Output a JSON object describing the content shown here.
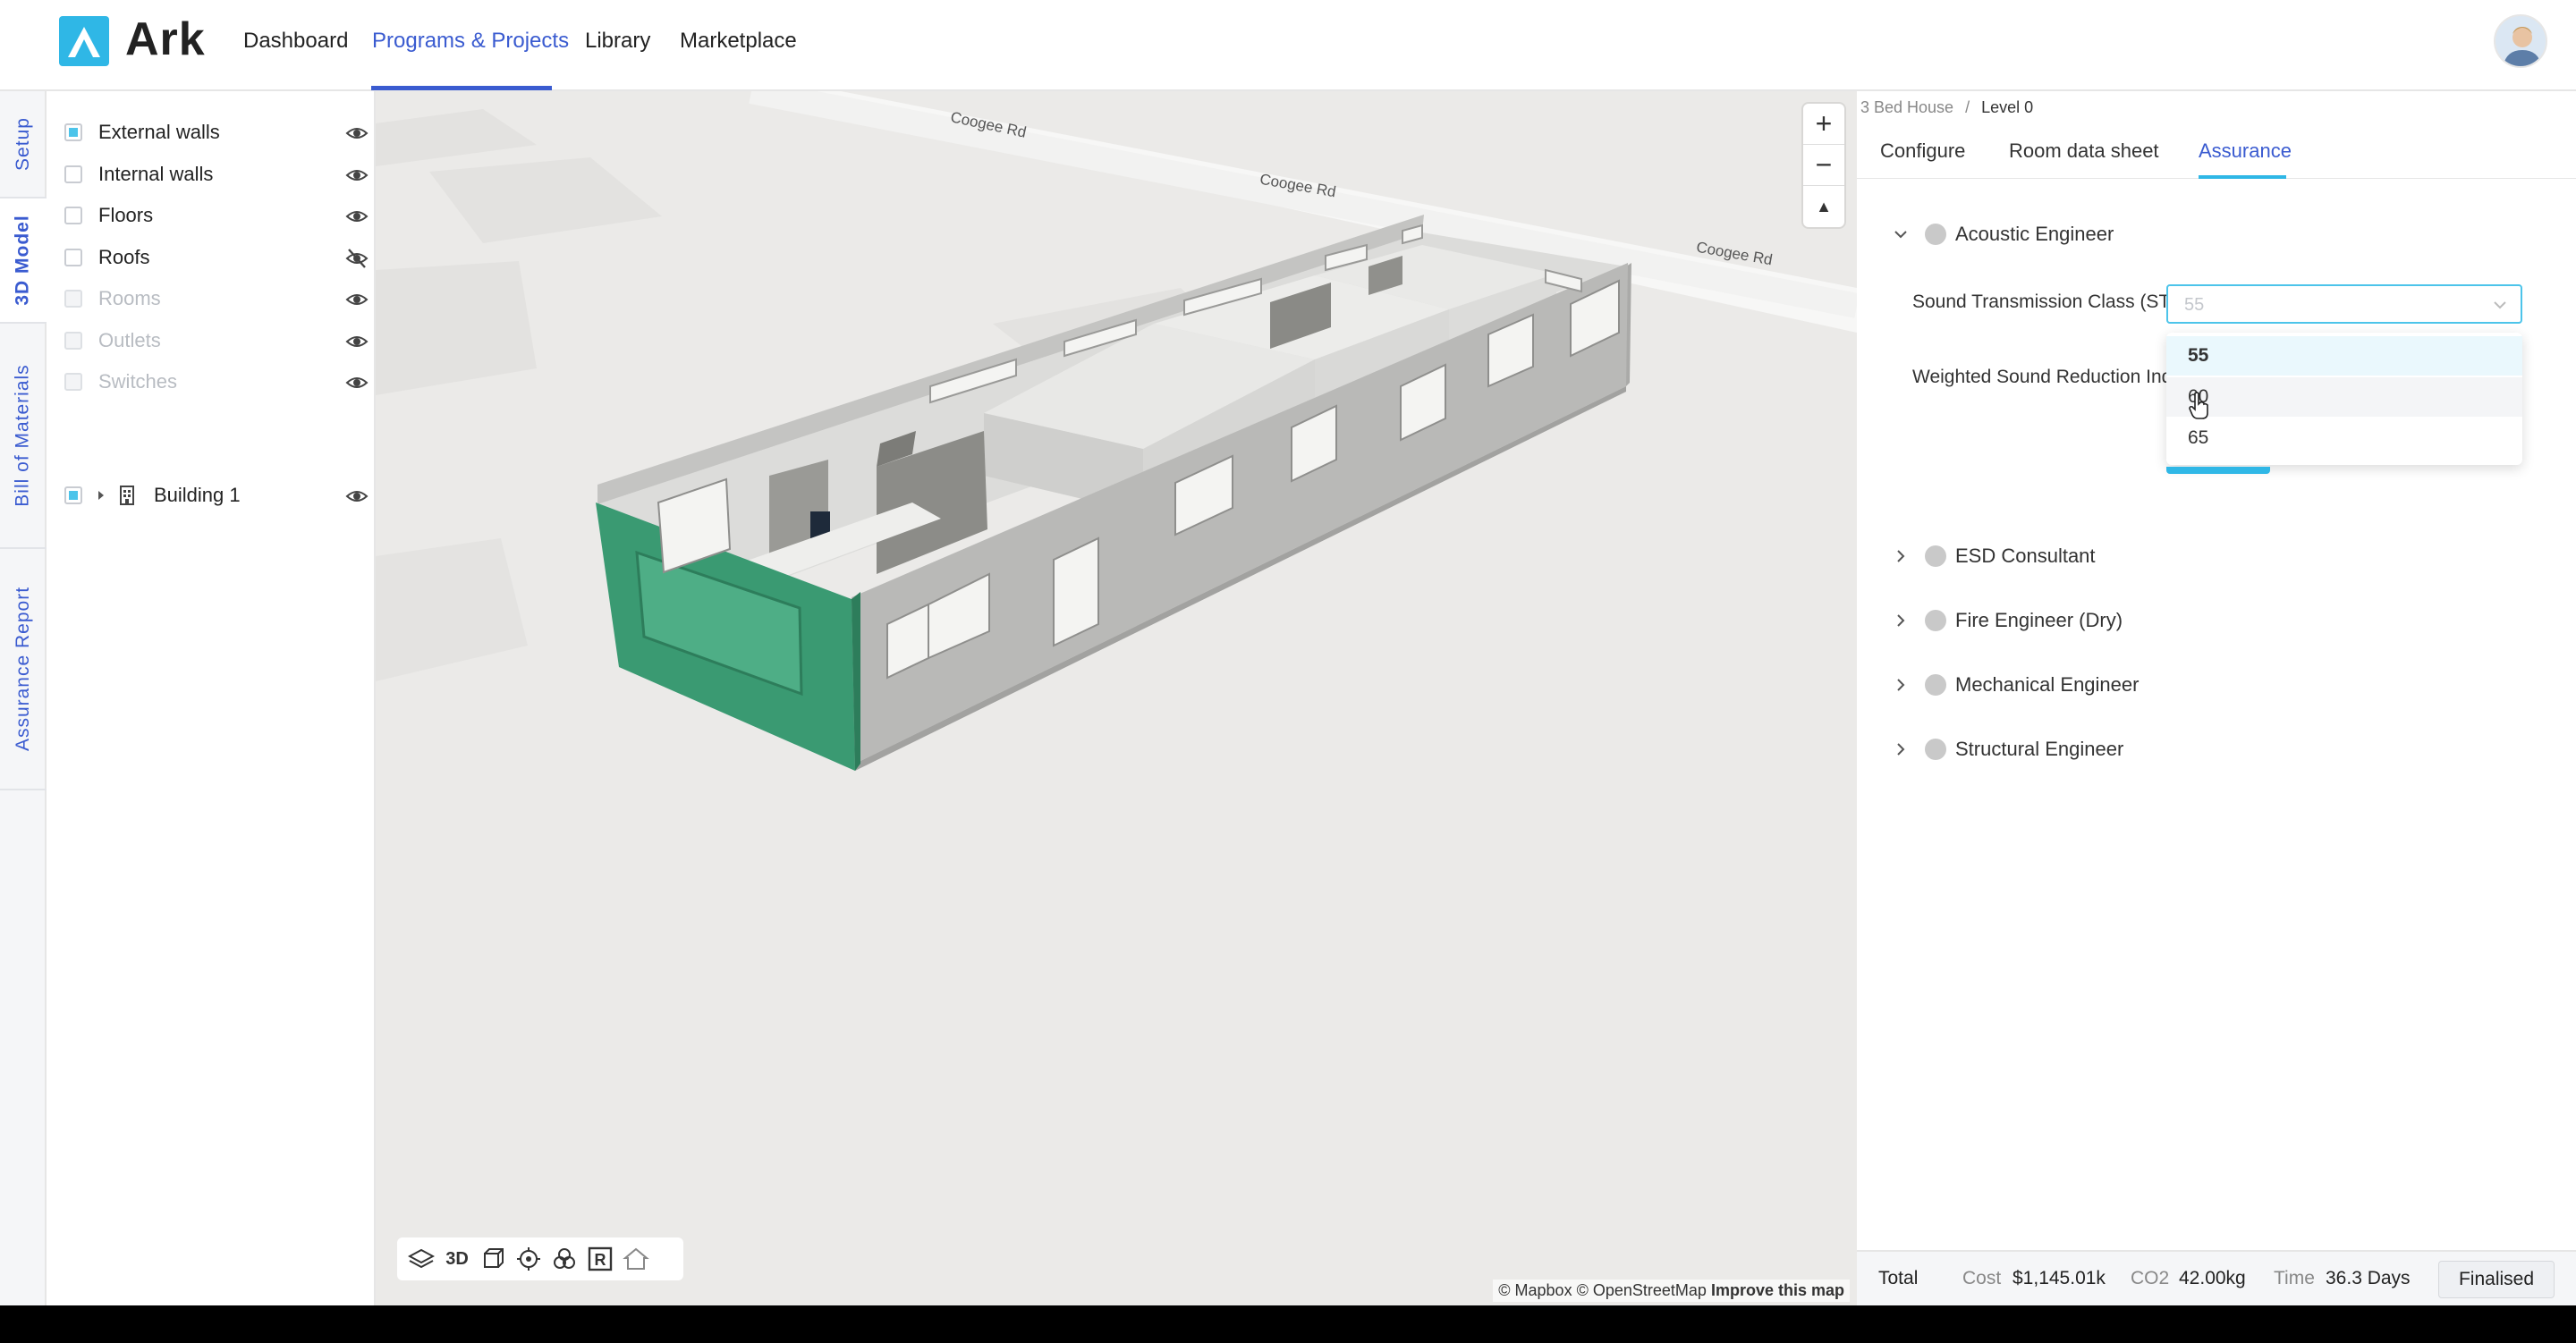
{
  "app": {
    "name": "Ark",
    "nav": [
      "Dashboard",
      "Programs & Projects",
      "Library",
      "Marketplace"
    ],
    "active_nav": "Programs & Projects"
  },
  "side_tabs": [
    "Setup",
    "3D Model",
    "Bill of Materials",
    "Assurance Report"
  ],
  "active_side_tab": "3D Model",
  "layers": [
    {
      "label": "External walls",
      "checked": true,
      "disabled": false,
      "visible": true
    },
    {
      "label": "Internal walls",
      "checked": false,
      "disabled": false,
      "visible": true
    },
    {
      "label": "Floors",
      "checked": false,
      "disabled": false,
      "visible": true
    },
    {
      "label": "Roofs",
      "checked": false,
      "disabled": false,
      "visible": false
    },
    {
      "label": "Rooms",
      "checked": false,
      "disabled": true,
      "visible": true
    },
    {
      "label": "Outlets",
      "checked": false,
      "disabled": true,
      "visible": true
    },
    {
      "label": "Switches",
      "checked": false,
      "disabled": true,
      "visible": true
    }
  ],
  "building": {
    "label": "Building 1",
    "checked": true
  },
  "map": {
    "road_labels": [
      "Coogee Rd",
      "Coogee Rd",
      "Coogee Rd"
    ],
    "zoom_in": "+",
    "zoom_out": "−",
    "compass": "▲",
    "attribution": {
      "mapbox": "© Mapbox",
      "osm": "© OpenStreetMap",
      "improve": "Improve this map"
    },
    "toolbar": [
      "layers-icon",
      "3D",
      "cube-icon",
      "target-icon",
      "circles-icon",
      "R",
      "home-icon"
    ],
    "colors": {
      "accent_wall": "#3a9a72",
      "wall": "#b9b9b7",
      "floor": "#e2e2e0",
      "ground": "#ebeae8"
    }
  },
  "right_panel": {
    "breadcrumb": [
      "3 Bed House",
      "Level 0"
    ],
    "tabs": [
      "Configure",
      "Room data sheet",
      "Assurance"
    ],
    "active_tab": "Assurance",
    "sections": [
      {
        "label": "Acoustic Engineer",
        "expanded": true
      },
      {
        "label": "ESD Consultant",
        "expanded": false
      },
      {
        "label": "Fire Engineer (Dry)",
        "expanded": false
      },
      {
        "label": "Mechanical Engineer",
        "expanded": false
      },
      {
        "label": "Structural Engineer",
        "expanded": false
      }
    ],
    "fields": [
      {
        "label": "Sound Transmission Class (STC)",
        "value": "55"
      },
      {
        "label": "Weighted Sound Reduction Index (Rw)"
      }
    ],
    "dropdown_options": [
      "55",
      "60",
      "65"
    ],
    "selected_option": "55",
    "hovered_option": "60",
    "footer": {
      "total_label": "Total",
      "cost_label": "Cost",
      "cost_value": "$1,145.01k",
      "co2_label": "CO2",
      "co2_value": "42.00kg",
      "time_label": "Time",
      "time_value": "36.3 Days",
      "status_button": "Finalised"
    }
  },
  "colors": {
    "accent": "#3a5bd0",
    "brand": "#2fb7e6"
  }
}
